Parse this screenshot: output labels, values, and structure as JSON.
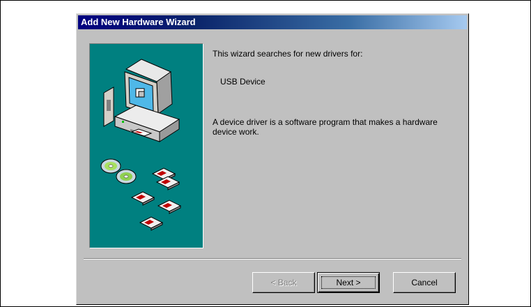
{
  "window": {
    "title": "Add New Hardware Wizard"
  },
  "content": {
    "intro": "This wizard searches for new drivers for:",
    "device_name": "USB Device",
    "description": "A device driver is a software program that makes a hardware device work."
  },
  "buttons": {
    "back": "< Back",
    "next": "Next >",
    "cancel": "Cancel"
  },
  "colors": {
    "title_start": "#000080",
    "title_end": "#a6caf0",
    "panel": "#008080",
    "dialog": "#c0c0c0"
  },
  "icons": {
    "illustration": "computer-with-cds-and-floppies"
  }
}
